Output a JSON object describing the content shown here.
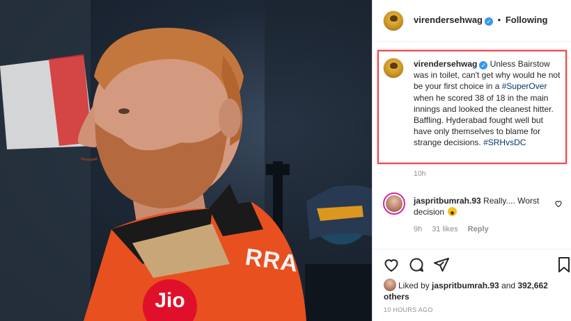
{
  "post": {
    "author": "virendersehwag",
    "follow_status": "Following",
    "separator": "•",
    "caption_parts": {
      "text1": " Unless Bairstow was in toilet, can't get why would he not be your first choice in a ",
      "hashtag1": "#SuperOver",
      "text2": " when he scored 38 of 18 in the main innings and looked the cleanest hitter. Baffling. Hyderabad fought well but have only themselves to blame for strange decisions. ",
      "hashtag2": "#SRHvsDC"
    },
    "caption_time": "10h",
    "highlight_color": "#e8484e"
  },
  "comment": {
    "author": "jaspritbumrah.93",
    "text": " Really.... Worst decision ",
    "time": "9h",
    "likes": "31 likes",
    "reply_label": "Reply"
  },
  "likes": {
    "prefix": "Liked by ",
    "user": "jaspritbumrah.93",
    "conjunction": " and ",
    "others": "392,662 others"
  },
  "posted_ago": "10 HOURS AGO",
  "photo": {
    "jersey_text": "RRA",
    "badge_text": "Jio"
  },
  "icons": {
    "verified": "verified-badge-icon",
    "heart": "heart-icon",
    "comment": "comment-icon",
    "share": "share-icon",
    "save": "bookmark-icon"
  },
  "colors": {
    "verified_blue": "#3897f0",
    "hashtag": "#00376b",
    "jersey_orange": "#e8501f",
    "jio_red": "#e0102a"
  }
}
